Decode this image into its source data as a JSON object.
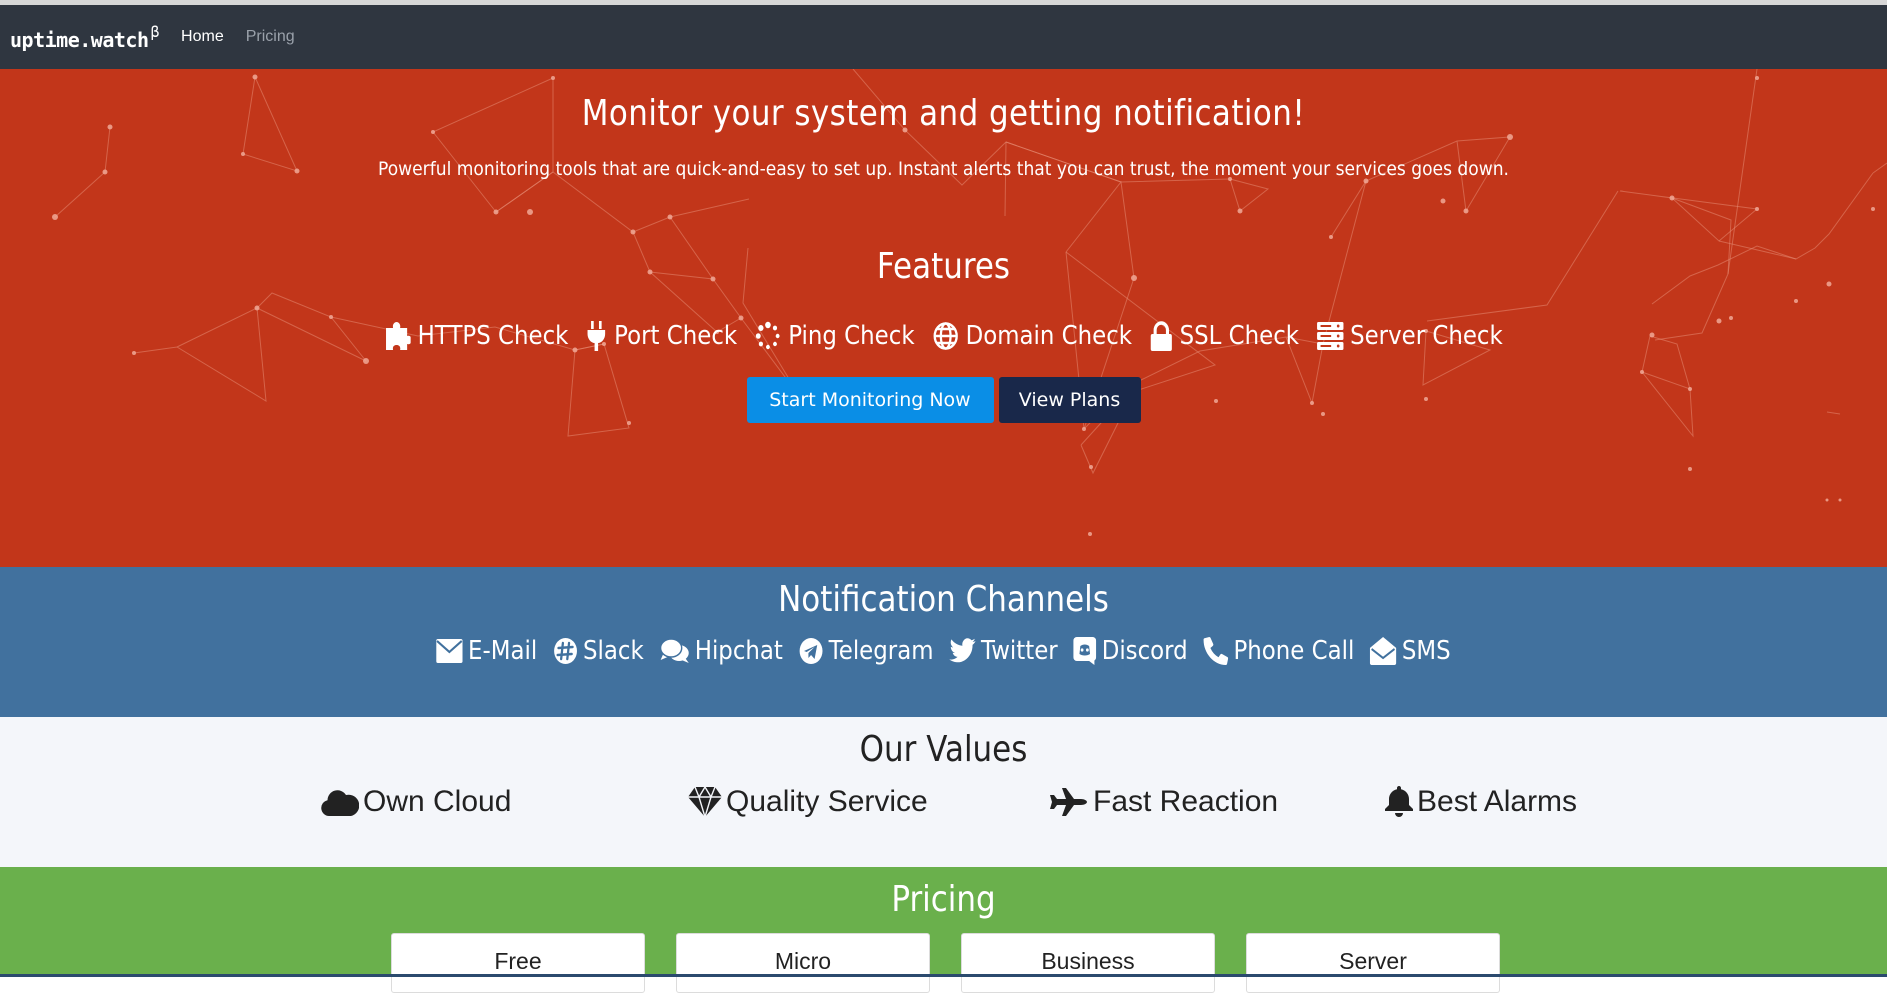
{
  "navbar": {
    "brand": "uptime.watch",
    "brand_sup": "β",
    "links": [
      {
        "label": "Home",
        "active": true
      },
      {
        "label": "Pricing",
        "active": false
      }
    ]
  },
  "hero": {
    "title": "Monitor your system and getting notification!",
    "subtitle": "Powerful monitoring tools that are quick-and-easy to set up. Instant alerts that you can trust, the moment your services goes down.",
    "features_title": "Features",
    "features": [
      {
        "icon": "puzzle-icon",
        "label": "HTTPS Check"
      },
      {
        "icon": "plug-icon",
        "label": "Port Check"
      },
      {
        "icon": "spinner-icon",
        "label": "Ping Check"
      },
      {
        "icon": "globe-icon",
        "label": "Domain Check"
      },
      {
        "icon": "lock-icon",
        "label": "SSL Check"
      },
      {
        "icon": "server-icon",
        "label": "Server Check"
      }
    ],
    "primary_button": "Start Monitoring Now",
    "secondary_button": "View Plans"
  },
  "notifications": {
    "title": "Notification Channels",
    "channels": [
      {
        "icon": "envelope-icon",
        "label": "E-Mail"
      },
      {
        "icon": "slack-icon",
        "label": "Slack"
      },
      {
        "icon": "comments-icon",
        "label": "Hipchat"
      },
      {
        "icon": "telegram-icon",
        "label": "Telegram"
      },
      {
        "icon": "twitter-icon",
        "label": "Twitter"
      },
      {
        "icon": "discord-icon",
        "label": "Discord"
      },
      {
        "icon": "phone-icon",
        "label": "Phone Call"
      },
      {
        "icon": "envelope-open-icon",
        "label": "SMS"
      }
    ]
  },
  "values": {
    "title": "Our Values",
    "items": [
      {
        "icon": "cloud-icon",
        "label": "Own Cloud"
      },
      {
        "icon": "diamond-icon",
        "label": "Quality Service"
      },
      {
        "icon": "plane-icon",
        "label": "Fast Reaction"
      },
      {
        "icon": "bell-icon",
        "label": "Best Alarms"
      }
    ]
  },
  "pricing": {
    "title": "Pricing",
    "plans": [
      "Free",
      "Micro",
      "Business",
      "Server"
    ]
  },
  "colors": {
    "navbar": "#2f3640",
    "hero": "#c2361a",
    "notifications": "#41719e",
    "values": "#f4f6fa",
    "pricing": "#6ab04c",
    "primary_button": "#0a8ee6",
    "secondary_button": "#19284a"
  }
}
